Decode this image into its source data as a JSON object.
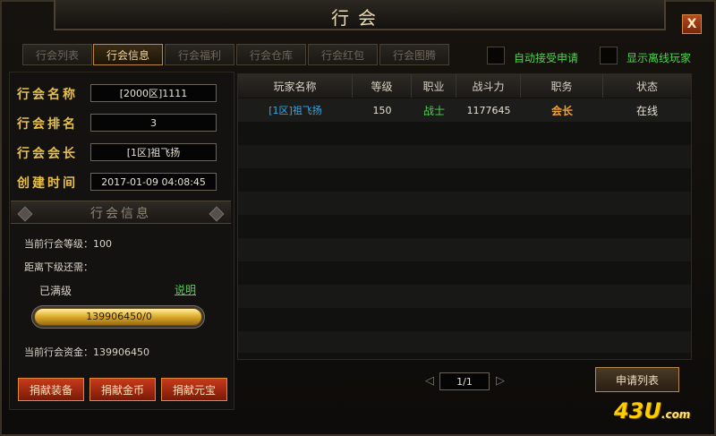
{
  "window": {
    "title": "行会",
    "close_label": "X"
  },
  "tabs": [
    {
      "label": "行会列表"
    },
    {
      "label": "行会信息"
    },
    {
      "label": "行会福利"
    },
    {
      "label": "行会仓库"
    },
    {
      "label": "行会红包"
    },
    {
      "label": "行会图腾"
    }
  ],
  "active_tab": "行会信息",
  "options": {
    "auto_accept_label": "自动接受申请",
    "show_offline_label": "显示离线玩家"
  },
  "guild_info": {
    "name_label": "行会名称",
    "name_value": "[2000区]1111",
    "rank_label": "行会排名",
    "rank_value": "3",
    "leader_label": "行会会长",
    "leader_value": "[1区]祖飞扬",
    "created_label": "创建时间",
    "created_value": "2017-01-09 04:08:45"
  },
  "section": {
    "title": "行会信息",
    "level_text": "当前行会等级：100",
    "next_level_text": "距离下级还需：",
    "maxed_text": "已满级",
    "explain_link": "说明",
    "progress_text": "139906450/0",
    "progress_fraction": 1.0,
    "funds_text": "当前行会资金：139906450"
  },
  "donate_buttons": {
    "equipment": "捐献装备",
    "gold": "捐献金币",
    "yuanbao": "捐献元宝"
  },
  "member_table": {
    "headers": [
      "玩家名称",
      "等级",
      "职业",
      "战斗力",
      "职务",
      "状态"
    ],
    "rows": [
      {
        "name": "[1区]祖飞扬",
        "level": "150",
        "class": "战士",
        "power": "1177645",
        "position": "会长",
        "status": "在线"
      }
    ]
  },
  "pager": {
    "text": "1/1"
  },
  "apply_list_label": "申请列表",
  "watermark": {
    "main": "43U",
    "suffix": ".com"
  },
  "colors": {
    "accent_gold": "#e6c04a",
    "online_green": "#4ed24e",
    "leader_orange": "#f0a030",
    "name_blue": "#3aa8e8"
  }
}
